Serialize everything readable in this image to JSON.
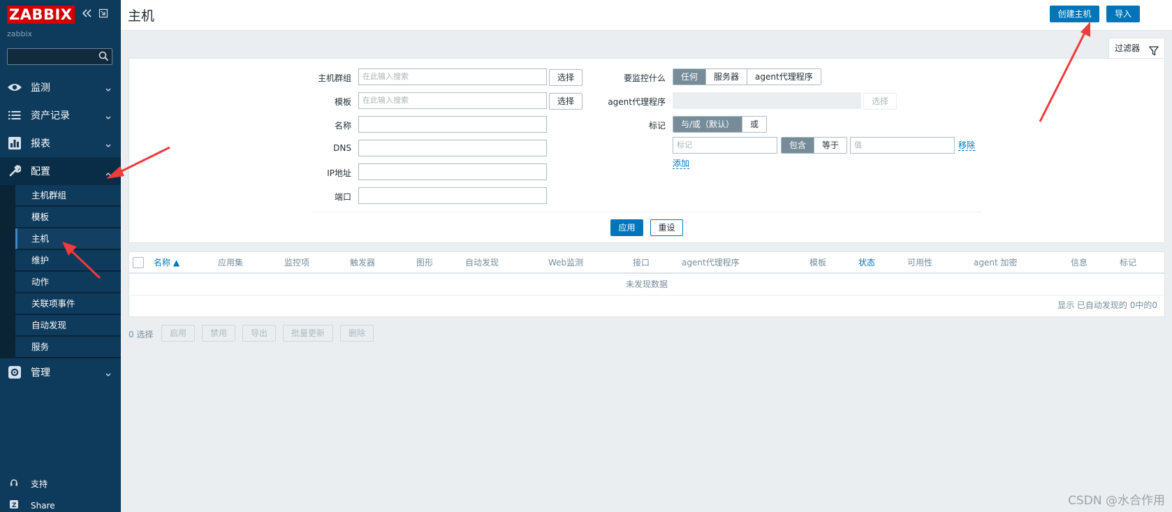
{
  "sidebar": {
    "logo": "ZABBIX",
    "server_name": "zabbix",
    "search_placeholder": "",
    "items": [
      {
        "label": "监测"
      },
      {
        "label": "资产记录"
      },
      {
        "label": "报表"
      },
      {
        "label": "配置"
      },
      {
        "label": "管理"
      }
    ],
    "config_submenu": [
      "主机群组",
      "模板",
      "主机",
      "维护",
      "动作",
      "关联项事件",
      "自动发现",
      "服务"
    ],
    "bottom": [
      {
        "label": "支持"
      },
      {
        "label": "Share"
      }
    ]
  },
  "header": {
    "title": "主机",
    "create_host": "创建主机",
    "import": "导入"
  },
  "filter": {
    "tab_label": "过滤器",
    "host_groups_label": "主机群组",
    "templates_label": "模板",
    "name_label": "名称",
    "dns_label": "DNS",
    "ip_label": "IP地址",
    "port_label": "端口",
    "search_placeholder": "在此输入搜索",
    "select_label": "选择",
    "monitored_by_label": "要监控什么",
    "monitored_by_options": [
      "任何",
      "服务器",
      "agent代理程序"
    ],
    "proxy_label": "agent代理程序",
    "tags_label": "标记",
    "tag_mode_options": [
      "与/或（默认）",
      "或"
    ],
    "tag_placeholder": "标记",
    "tag_op_options": [
      "包含",
      "等于"
    ],
    "value_placeholder": "值",
    "remove_label": "移除",
    "add_label": "添加",
    "apply_label": "应用",
    "reset_label": "重设"
  },
  "table": {
    "columns": [
      "名称 ▲",
      "应用集",
      "监控项",
      "触发器",
      "图形",
      "自动发现",
      "Web监测",
      "接口",
      "agent代理程序",
      "模板",
      "状态",
      "可用性",
      "agent 加密",
      "信息",
      "标记"
    ],
    "empty_text": "未发现数据",
    "footer": "显示 已自动发现的 0中的0"
  },
  "bulk": {
    "selected": "0 选择",
    "actions": [
      "启用",
      "禁用",
      "导出",
      "批量更新",
      "删除"
    ]
  },
  "watermark": "CSDN @水合作用",
  "colors": {
    "accent": "#0275b8",
    "sidebar": "#0e3a5b",
    "logo": "#d40000",
    "annotation_arrow": "#ee3b3b"
  }
}
